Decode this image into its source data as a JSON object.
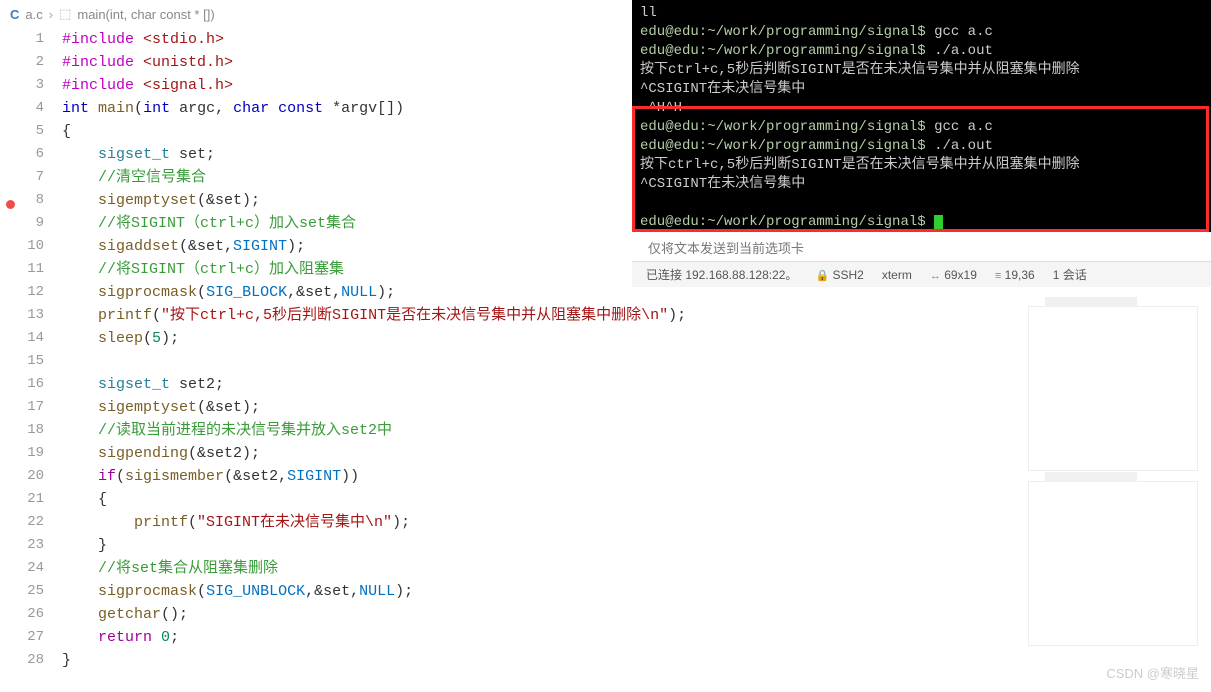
{
  "breadcrumb": {
    "file": "a.c",
    "symbol": "main(int, char const * [])"
  },
  "lines": [
    [
      [
        "inc",
        "#include"
      ],
      [
        "op",
        " "
      ],
      [
        "str",
        "<stdio.h>"
      ]
    ],
    [
      [
        "inc",
        "#include"
      ],
      [
        "op",
        " "
      ],
      [
        "str",
        "<unistd.h>"
      ]
    ],
    [
      [
        "inc",
        "#include"
      ],
      [
        "op",
        " "
      ],
      [
        "str",
        "<signal.h>"
      ]
    ],
    [
      [
        "kw",
        "int"
      ],
      [
        "op",
        " "
      ],
      [
        "fn",
        "main"
      ],
      [
        "op",
        "("
      ],
      [
        "kw",
        "int"
      ],
      [
        "op",
        " argc, "
      ],
      [
        "kw",
        "char"
      ],
      [
        "op",
        " "
      ],
      [
        "kw",
        "const"
      ],
      [
        "op",
        " *argv[])"
      ]
    ],
    [
      [
        "op",
        "{"
      ]
    ],
    [
      [
        "op",
        "    "
      ],
      [
        "type",
        "sigset_t"
      ],
      [
        "op",
        " set;"
      ]
    ],
    [
      [
        "op",
        "    "
      ],
      [
        "cmt",
        "//清空信号集合"
      ]
    ],
    [
      [
        "op",
        "    "
      ],
      [
        "fn",
        "sigemptyset"
      ],
      [
        "op",
        "(&set);"
      ]
    ],
    [
      [
        "op",
        "    "
      ],
      [
        "cmt",
        "//将SIGINT（ctrl+c）加入set集合"
      ]
    ],
    [
      [
        "op",
        "    "
      ],
      [
        "fn",
        "sigaddset"
      ],
      [
        "op",
        "(&set,"
      ],
      [
        "const",
        "SIGINT"
      ],
      [
        "op",
        ");"
      ]
    ],
    [
      [
        "op",
        "    "
      ],
      [
        "cmt",
        "//将SIGINT（ctrl+c）加入阻塞集"
      ]
    ],
    [
      [
        "op",
        "    "
      ],
      [
        "fn",
        "sigprocmask"
      ],
      [
        "op",
        "("
      ],
      [
        "const",
        "SIG_BLOCK"
      ],
      [
        "op",
        ",&set,"
      ],
      [
        "const",
        "NULL"
      ],
      [
        "op",
        ");"
      ]
    ],
    [
      [
        "op",
        "    "
      ],
      [
        "fn",
        "printf"
      ],
      [
        "op",
        "("
      ],
      [
        "str",
        "\"按下ctrl+c,5秒后判断SIGINT是否在未决信号集中并从阻塞集中删除\\n\""
      ],
      [
        "op",
        ");"
      ]
    ],
    [
      [
        "op",
        "    "
      ],
      [
        "fn",
        "sleep"
      ],
      [
        "op",
        "("
      ],
      [
        "num",
        "5"
      ],
      [
        "op",
        ");"
      ]
    ],
    [
      [
        "op",
        ""
      ]
    ],
    [
      [
        "op",
        "    "
      ],
      [
        "type",
        "sigset_t"
      ],
      [
        "op",
        " set2;"
      ]
    ],
    [
      [
        "op",
        "    "
      ],
      [
        "fn",
        "sigemptyset"
      ],
      [
        "op",
        "(&set);"
      ]
    ],
    [
      [
        "op",
        "    "
      ],
      [
        "cmt",
        "//读取当前进程的未决信号集并放入set2中"
      ]
    ],
    [
      [
        "op",
        "    "
      ],
      [
        "fn",
        "sigpending"
      ],
      [
        "op",
        "(&set2);"
      ]
    ],
    [
      [
        "op",
        "    "
      ],
      [
        "ctrl",
        "if"
      ],
      [
        "op",
        "("
      ],
      [
        "fn",
        "sigismember"
      ],
      [
        "op",
        "(&set2,"
      ],
      [
        "const",
        "SIGINT"
      ],
      [
        "op",
        "))"
      ]
    ],
    [
      [
        "op",
        "    {"
      ]
    ],
    [
      [
        "op",
        "        "
      ],
      [
        "fn",
        "printf"
      ],
      [
        "op",
        "("
      ],
      [
        "str",
        "\"SIGINT在未决信号集中\\n\""
      ],
      [
        "op",
        ");"
      ]
    ],
    [
      [
        "op",
        "    }"
      ]
    ],
    [
      [
        "op",
        "    "
      ],
      [
        "cmt",
        "//将set集合从阻塞集删除"
      ]
    ],
    [
      [
        "op",
        "    "
      ],
      [
        "fn",
        "sigprocmask"
      ],
      [
        "op",
        "("
      ],
      [
        "const",
        "SIG_UNBLOCK"
      ],
      [
        "op",
        ",&set,"
      ],
      [
        "const",
        "NULL"
      ],
      [
        "op",
        ");"
      ]
    ],
    [
      [
        "op",
        "    "
      ],
      [
        "fn",
        "getchar"
      ],
      [
        "op",
        "();"
      ]
    ],
    [
      [
        "op",
        "    "
      ],
      [
        "ctrl",
        "return"
      ],
      [
        "op",
        " "
      ],
      [
        "num",
        "0"
      ],
      [
        "op",
        ";"
      ]
    ],
    [
      [
        "op",
        "}"
      ]
    ]
  ],
  "terminal": [
    "ll",
    "edu@edu:~/work/programming/signal$ gcc a.c",
    "edu@edu:~/work/programming/signal$ ./a.out",
    "按下ctrl+c,5秒后判断SIGINT是否在未决信号集中并从阻塞集中删除",
    "^CSIGINT在未决信号集中",
    " ^H^H",
    "edu@edu:~/work/programming/signal$ gcc a.c",
    "edu@edu:~/work/programming/signal$ ./a.out",
    "按下ctrl+c,5秒后判断SIGINT是否在未决信号集中并从阻塞集中删除",
    "^CSIGINT在未决信号集中",
    "",
    "edu@edu:~/work/programming/signal$ "
  ],
  "tab_text": "仅将文本发送到当前选项卡",
  "status": {
    "conn": "已连接  192.168.88.128:22。",
    "proto": "SSH2",
    "term": "xterm",
    "size": "69x19",
    "pos": "19,36",
    "sess": "1 会话"
  },
  "watermark": "CSDN @寒晓星"
}
